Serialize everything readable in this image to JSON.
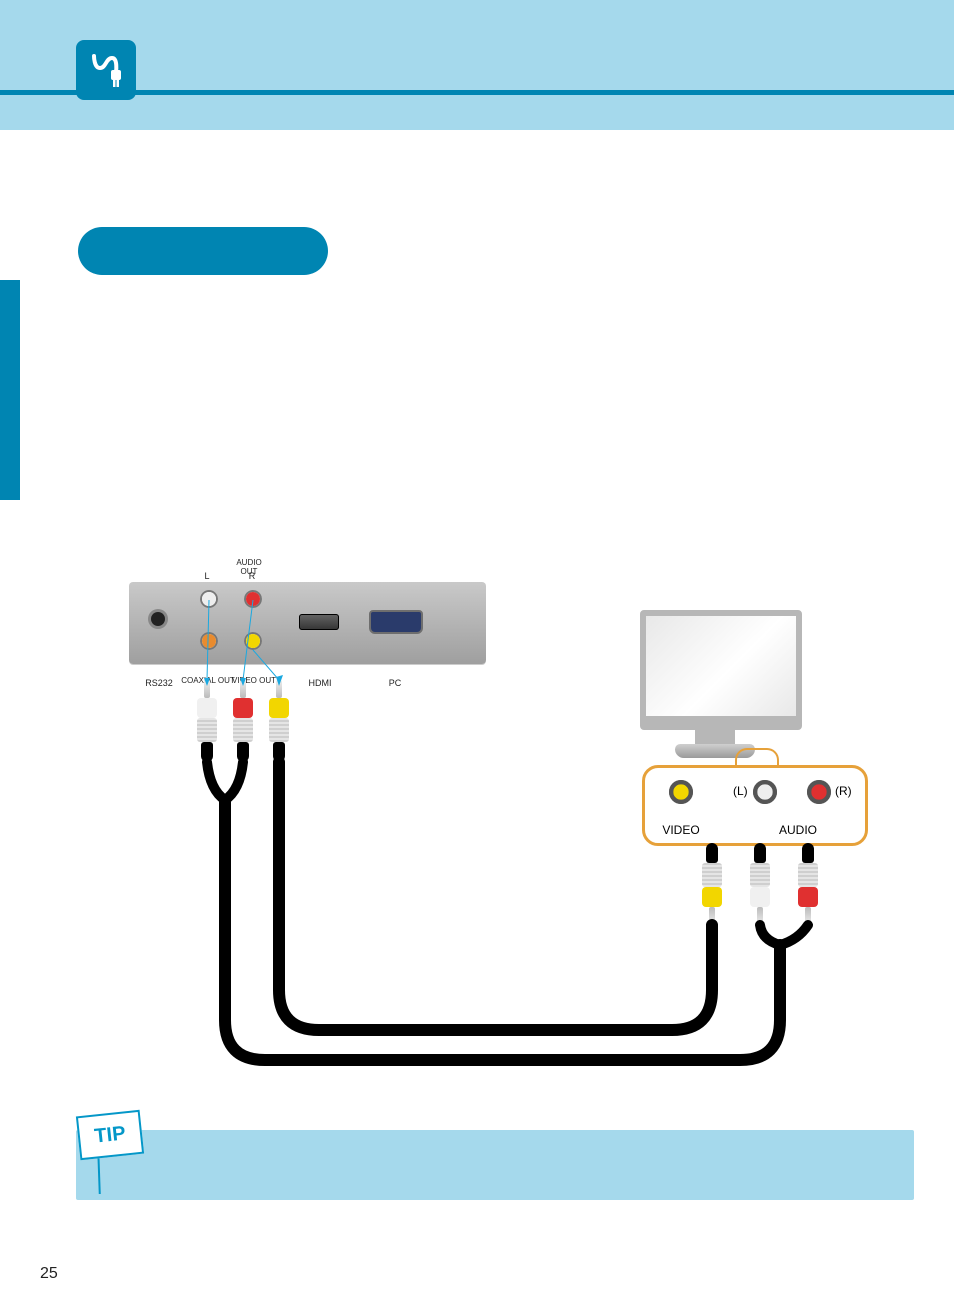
{
  "page_number": "25",
  "tip_label": "TIP",
  "dvr_panel": {
    "audio_out_label": "AUDIO OUT",
    "audio_l": "L",
    "audio_r": "R",
    "below_labels": {
      "rs232": "RS232",
      "coaxial_out": "COAXIAL OUT",
      "video_out": "VIDEO OUT",
      "hdmi": "HDMI",
      "pc": "PC"
    }
  },
  "monitor": {
    "video": "VIDEO",
    "audio": "AUDIO",
    "l": "(L)",
    "r": "(R)"
  },
  "colors": {
    "accent": "#0085b2",
    "light_accent": "#a5d9ec",
    "callout": "#e6a13a",
    "rca_yellow": "#f2d600",
    "rca_red": "#e03030",
    "rca_white": "#f0f0f0"
  }
}
